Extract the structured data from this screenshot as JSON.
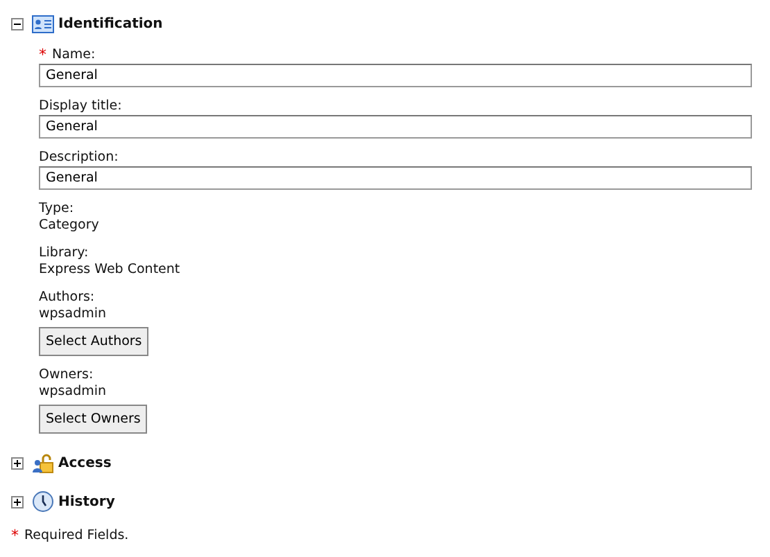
{
  "required_marker": "*",
  "sections": [
    {
      "title": "Identification",
      "expanded": true,
      "fields": [
        {
          "kind": "input",
          "label": "Name:",
          "required": true,
          "value": "General"
        },
        {
          "kind": "input",
          "label": "Display title:",
          "required": false,
          "value": "General"
        },
        {
          "kind": "input",
          "label": "Description:",
          "required": false,
          "value": "General"
        },
        {
          "kind": "text",
          "label": "Type:",
          "value": "Category"
        },
        {
          "kind": "text",
          "label": "Library:",
          "value": "Express Web Content"
        },
        {
          "kind": "people",
          "label": "Authors:",
          "value": "wpsadmin",
          "button": "Select Authors"
        },
        {
          "kind": "people",
          "label": "Owners:",
          "value": "wpsadmin",
          "button": "Select Owners"
        }
      ]
    },
    {
      "title": "Access",
      "expanded": false
    },
    {
      "title": "History",
      "expanded": false
    }
  ],
  "footer": "Required Fields."
}
